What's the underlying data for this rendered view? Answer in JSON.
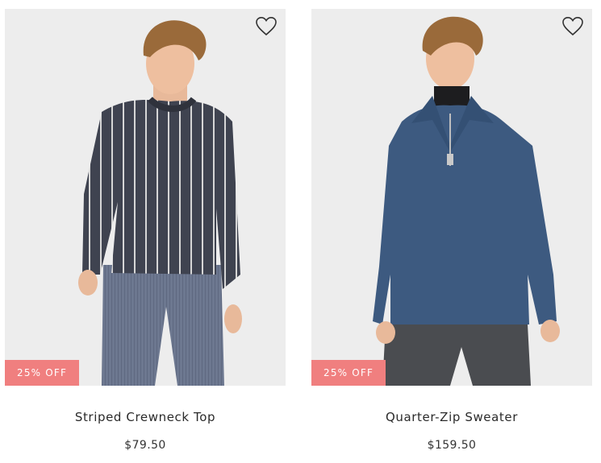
{
  "products": [
    {
      "name": "Striped Crewneck Top",
      "price": "$79.50",
      "badge": "25% OFF",
      "wishlist_icon": "heart-outline-icon",
      "colors": {
        "top": "#3f4350",
        "stripe": "#d9d9d9",
        "pants": "#6f7a92"
      }
    },
    {
      "name": "Quarter-Zip Sweater",
      "price": "$159.50",
      "badge": "25% OFF",
      "wishlist_icon": "heart-outline-icon",
      "colors": {
        "top": "#3d5a80",
        "pants": "#4a4c50"
      }
    }
  ],
  "badge_color": "#f07f7f"
}
